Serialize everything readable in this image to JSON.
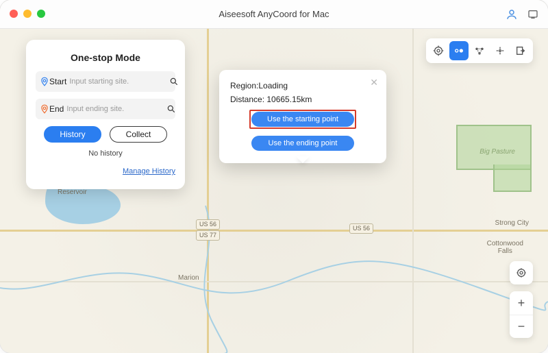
{
  "titlebar": {
    "title": "Aiseesoft AnyCoord for Mac"
  },
  "panel": {
    "heading": "One-stop Mode",
    "start_label": "Start",
    "start_placeholder": "Input starting site.",
    "end_label": "End",
    "end_placeholder": "Input ending site.",
    "history_btn": "History",
    "collect_btn": "Collect",
    "no_history": "No history",
    "manage_link": "Manage History"
  },
  "popover": {
    "region_label": "Region:",
    "region_value": "Loading",
    "distance_label": "Distance: ",
    "distance_value": "10665.15km",
    "btn_start": "Use the starting point",
    "btn_end": "Use the ending point"
  },
  "map_labels": {
    "us56a": "US 56",
    "us77": "US 77",
    "us56b": "US 56",
    "marion": "Marion",
    "marion_res": "Marion\nReservoir",
    "strong_city": "Strong City",
    "cottonwood": "Cottonwood\nFalls",
    "big_pasture": "Big Pasture"
  },
  "icons": {
    "start_pin": "📍",
    "end_pin": "📍"
  }
}
